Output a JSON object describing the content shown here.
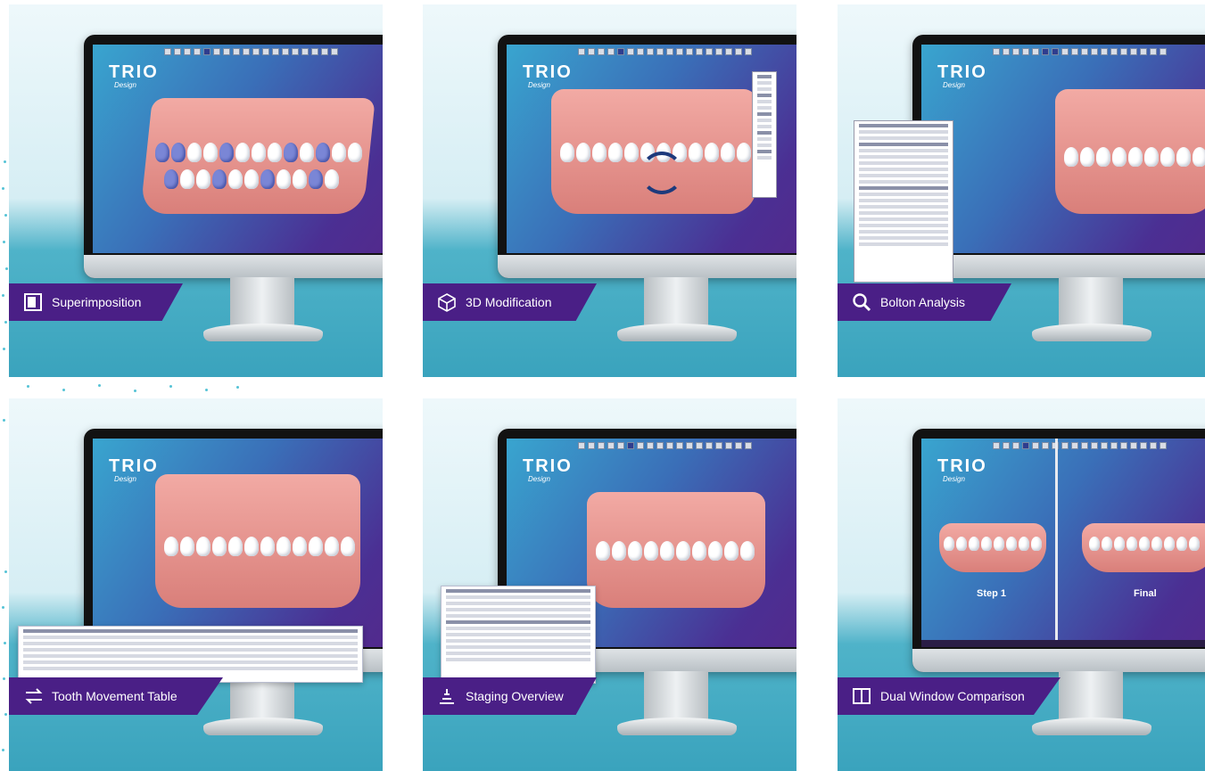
{
  "app": {
    "logo_main": "TRIO",
    "logo_sub": "Design"
  },
  "panels": [
    {
      "id": "superimposition",
      "label": "Superimposition",
      "icon": "superimposition-icon"
    },
    {
      "id": "3d-modification",
      "label": "3D Modification",
      "icon": "cube-icon"
    },
    {
      "id": "bolton-analysis",
      "label": "Bolton Analysis",
      "icon": "magnifier-icon"
    },
    {
      "id": "tooth-movement-table",
      "label": "Tooth Movement Table",
      "icon": "swap-arrows-icon"
    },
    {
      "id": "staging-overview",
      "label": "Staging Overview",
      "icon": "staging-icon"
    },
    {
      "id": "dual-window-comparison",
      "label": "Dual Window Comparison",
      "icon": "dual-window-icon"
    }
  ],
  "dual_window": {
    "left_caption": "Step 1",
    "right_caption": "Final"
  },
  "colors": {
    "label_purple": "#4a1f86",
    "screen_blue": "#39a5cf",
    "screen_purple": "#55288a",
    "accent_teal": "#4fb3c9"
  }
}
